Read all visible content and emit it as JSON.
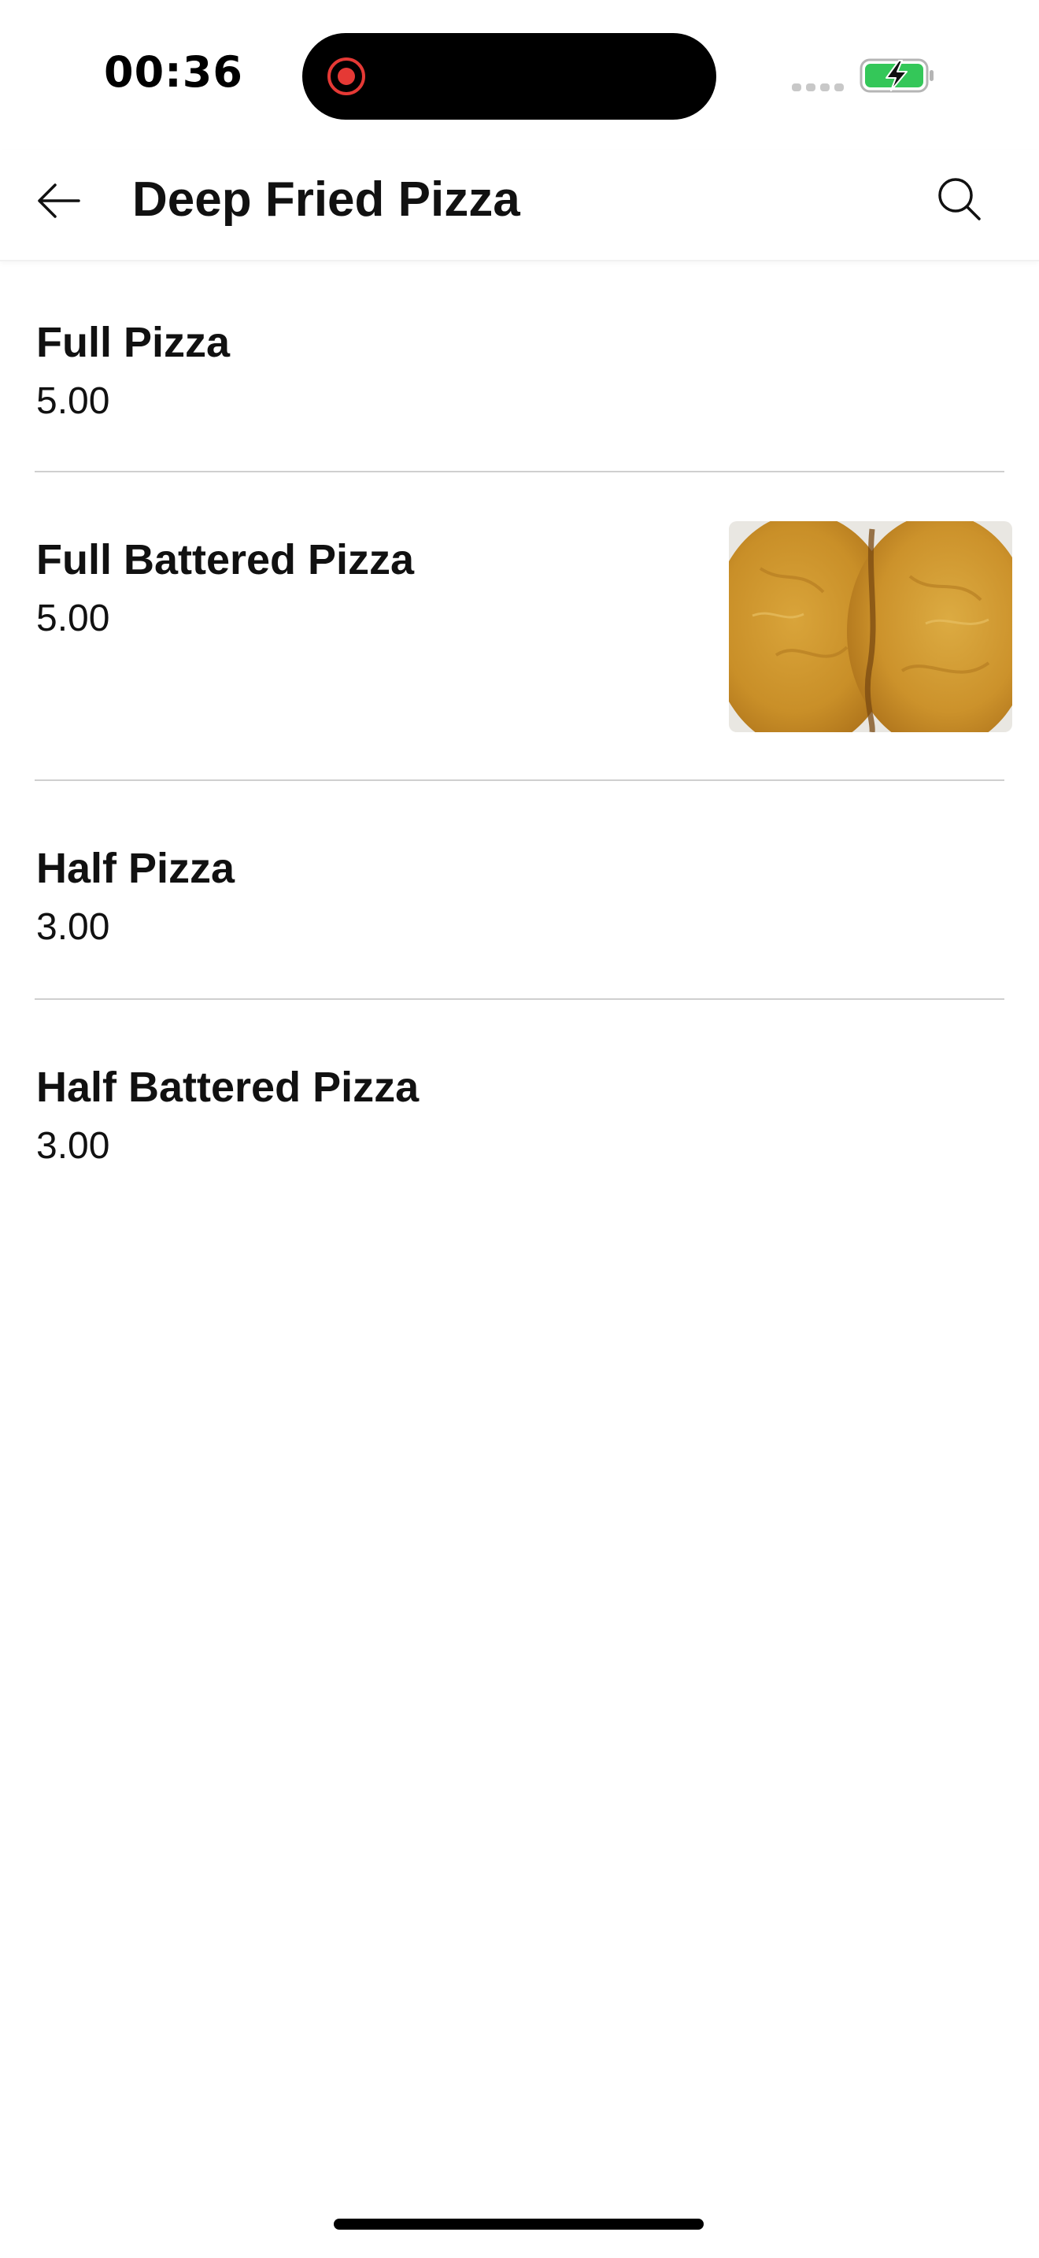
{
  "status_bar": {
    "time": "00:36",
    "record_icon": "screen-recording-icon",
    "signal_icon": "cellular-signal-icon",
    "battery_icon": "battery-charging-icon",
    "battery_color": "#34c759"
  },
  "header": {
    "back_icon": "arrow-left-icon",
    "title": "Deep Fried Pizza",
    "search_icon": "search-icon"
  },
  "menu": {
    "items": [
      {
        "name": "Full Pizza",
        "price": "5.00",
        "has_image": false
      },
      {
        "name": "Full Battered Pizza",
        "price": "5.00",
        "has_image": true
      },
      {
        "name": "Half Pizza",
        "price": "3.00",
        "has_image": false
      },
      {
        "name": "Half Battered Pizza",
        "price": "3.00",
        "has_image": false
      }
    ]
  },
  "colors": {
    "text": "#111111",
    "divider": "#cfcfcf",
    "record_red": "#e53935"
  }
}
